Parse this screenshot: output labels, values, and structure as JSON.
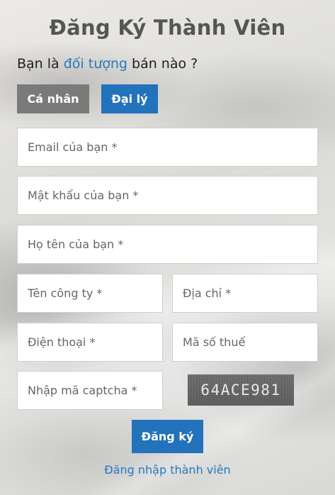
{
  "form": {
    "title": "Đăng Ký Thành Viên",
    "question": {
      "prefix": "Bạn là ",
      "highlight": "đối tượng",
      "suffix": " bán nào ?"
    },
    "account_types": {
      "personal": "Cá nhân",
      "agent": "Đại lý",
      "selected": "Đại lý"
    },
    "fields": {
      "email": "Email của bạn *",
      "password": "Mật khẩu của bạn *",
      "full_name": "Họ tên của bạn *",
      "company": "Tên công ty *",
      "address": "Địa chỉ *",
      "phone": "Điện thoại *",
      "tax_code": "Mã số thuế",
      "captcha": "Nhập mã captcha *"
    },
    "captcha_code": "64ACE981",
    "submit_label": "Đăng ký",
    "login_link": "Đăng nhập thành viên"
  },
  "colors": {
    "accent": "#2272bc",
    "link": "#2878c0",
    "inactive_button": "#7a7a7a",
    "title": "#555555"
  }
}
